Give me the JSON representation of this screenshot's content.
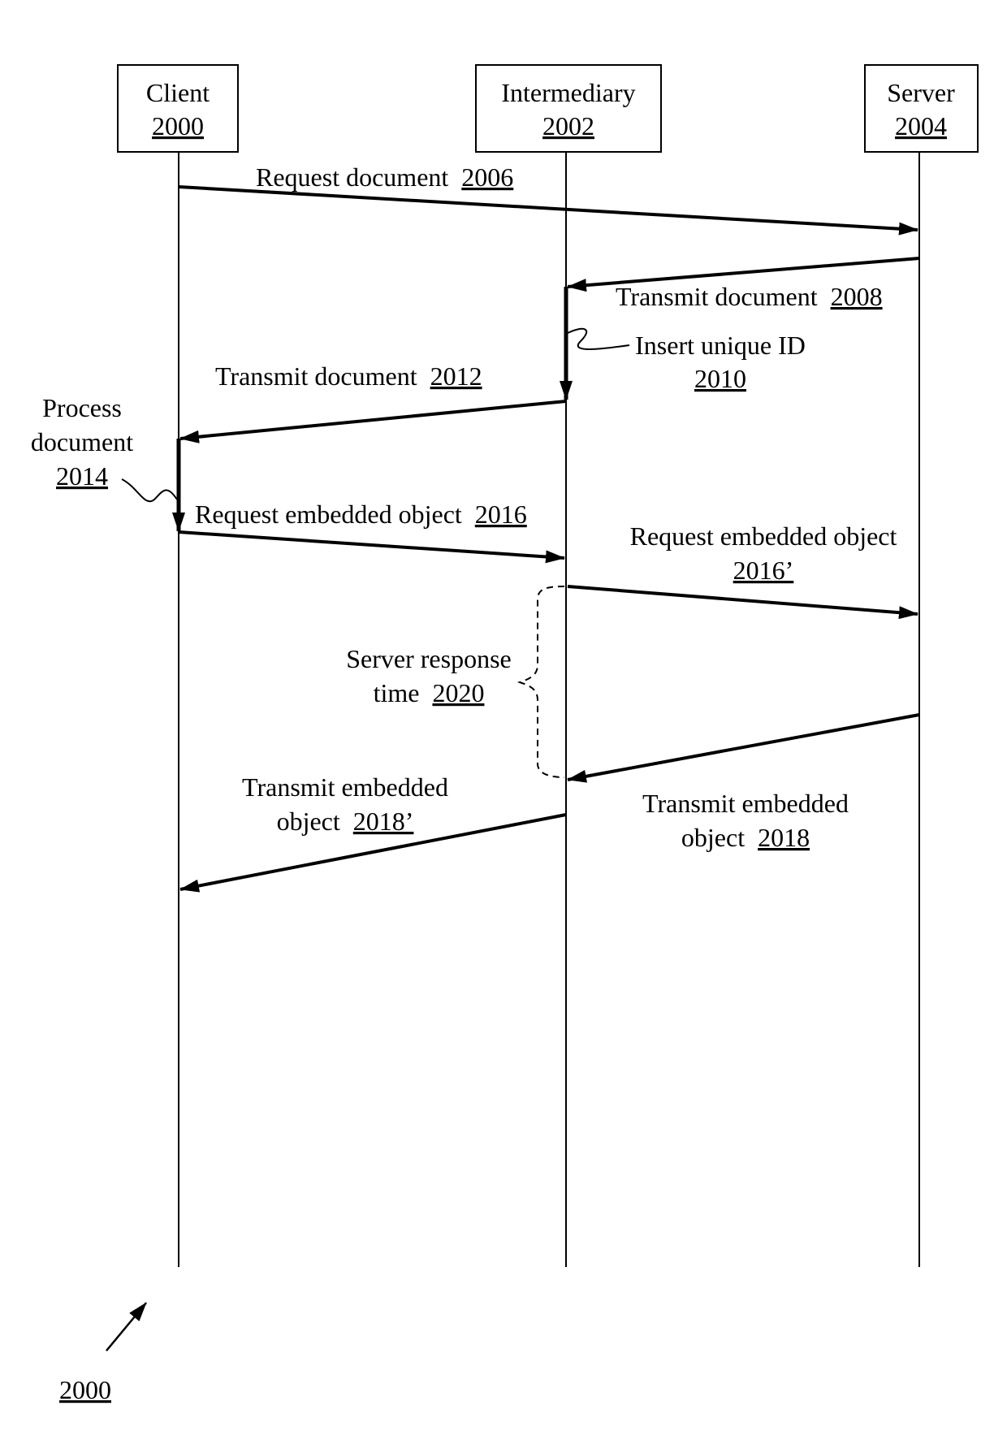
{
  "figure_ref": "2000",
  "participants": [
    {
      "id": "client",
      "name": "Client",
      "ref": "2000"
    },
    {
      "id": "intermediary",
      "name": "Intermediary",
      "ref": "2002"
    },
    {
      "id": "server",
      "name": "Server",
      "ref": "2004"
    }
  ],
  "messages": [
    {
      "id": "m2006",
      "from": "client",
      "to": "server",
      "text": "Request document",
      "ref": "2006"
    },
    {
      "id": "m2008",
      "from": "server",
      "to": "intermediary",
      "text": "Transmit document",
      "ref": "2008"
    },
    {
      "id": "m2012",
      "from": "intermediary",
      "to": "client",
      "text": "Transmit document",
      "ref": "2012"
    },
    {
      "id": "m2016",
      "from": "client",
      "to": "intermediary",
      "text": "Request embedded object",
      "ref": "2016"
    },
    {
      "id": "m2016p",
      "from": "intermediary",
      "to": "server",
      "text": "Request embedded object",
      "ref": "2016’"
    },
    {
      "id": "m2018",
      "from": "server",
      "to": "intermediary",
      "text_line1": "Transmit embedded",
      "text_line2": "object",
      "ref": "2018"
    },
    {
      "id": "m2018p",
      "from": "intermediary",
      "to": "client",
      "text_line1": "Transmit embedded",
      "text_line2": "object",
      "ref": "2018’"
    }
  ],
  "activities": [
    {
      "id": "a2010",
      "on": "intermediary",
      "text": "Insert unique ID",
      "ref": "2010"
    },
    {
      "id": "a2014",
      "on": "client",
      "text_line1": "Process",
      "text_line2": "document",
      "ref": "2014"
    }
  ],
  "annotations": [
    {
      "id": "t2020",
      "text_line1": "Server response",
      "text_line2": "time",
      "ref": "2020"
    }
  ]
}
